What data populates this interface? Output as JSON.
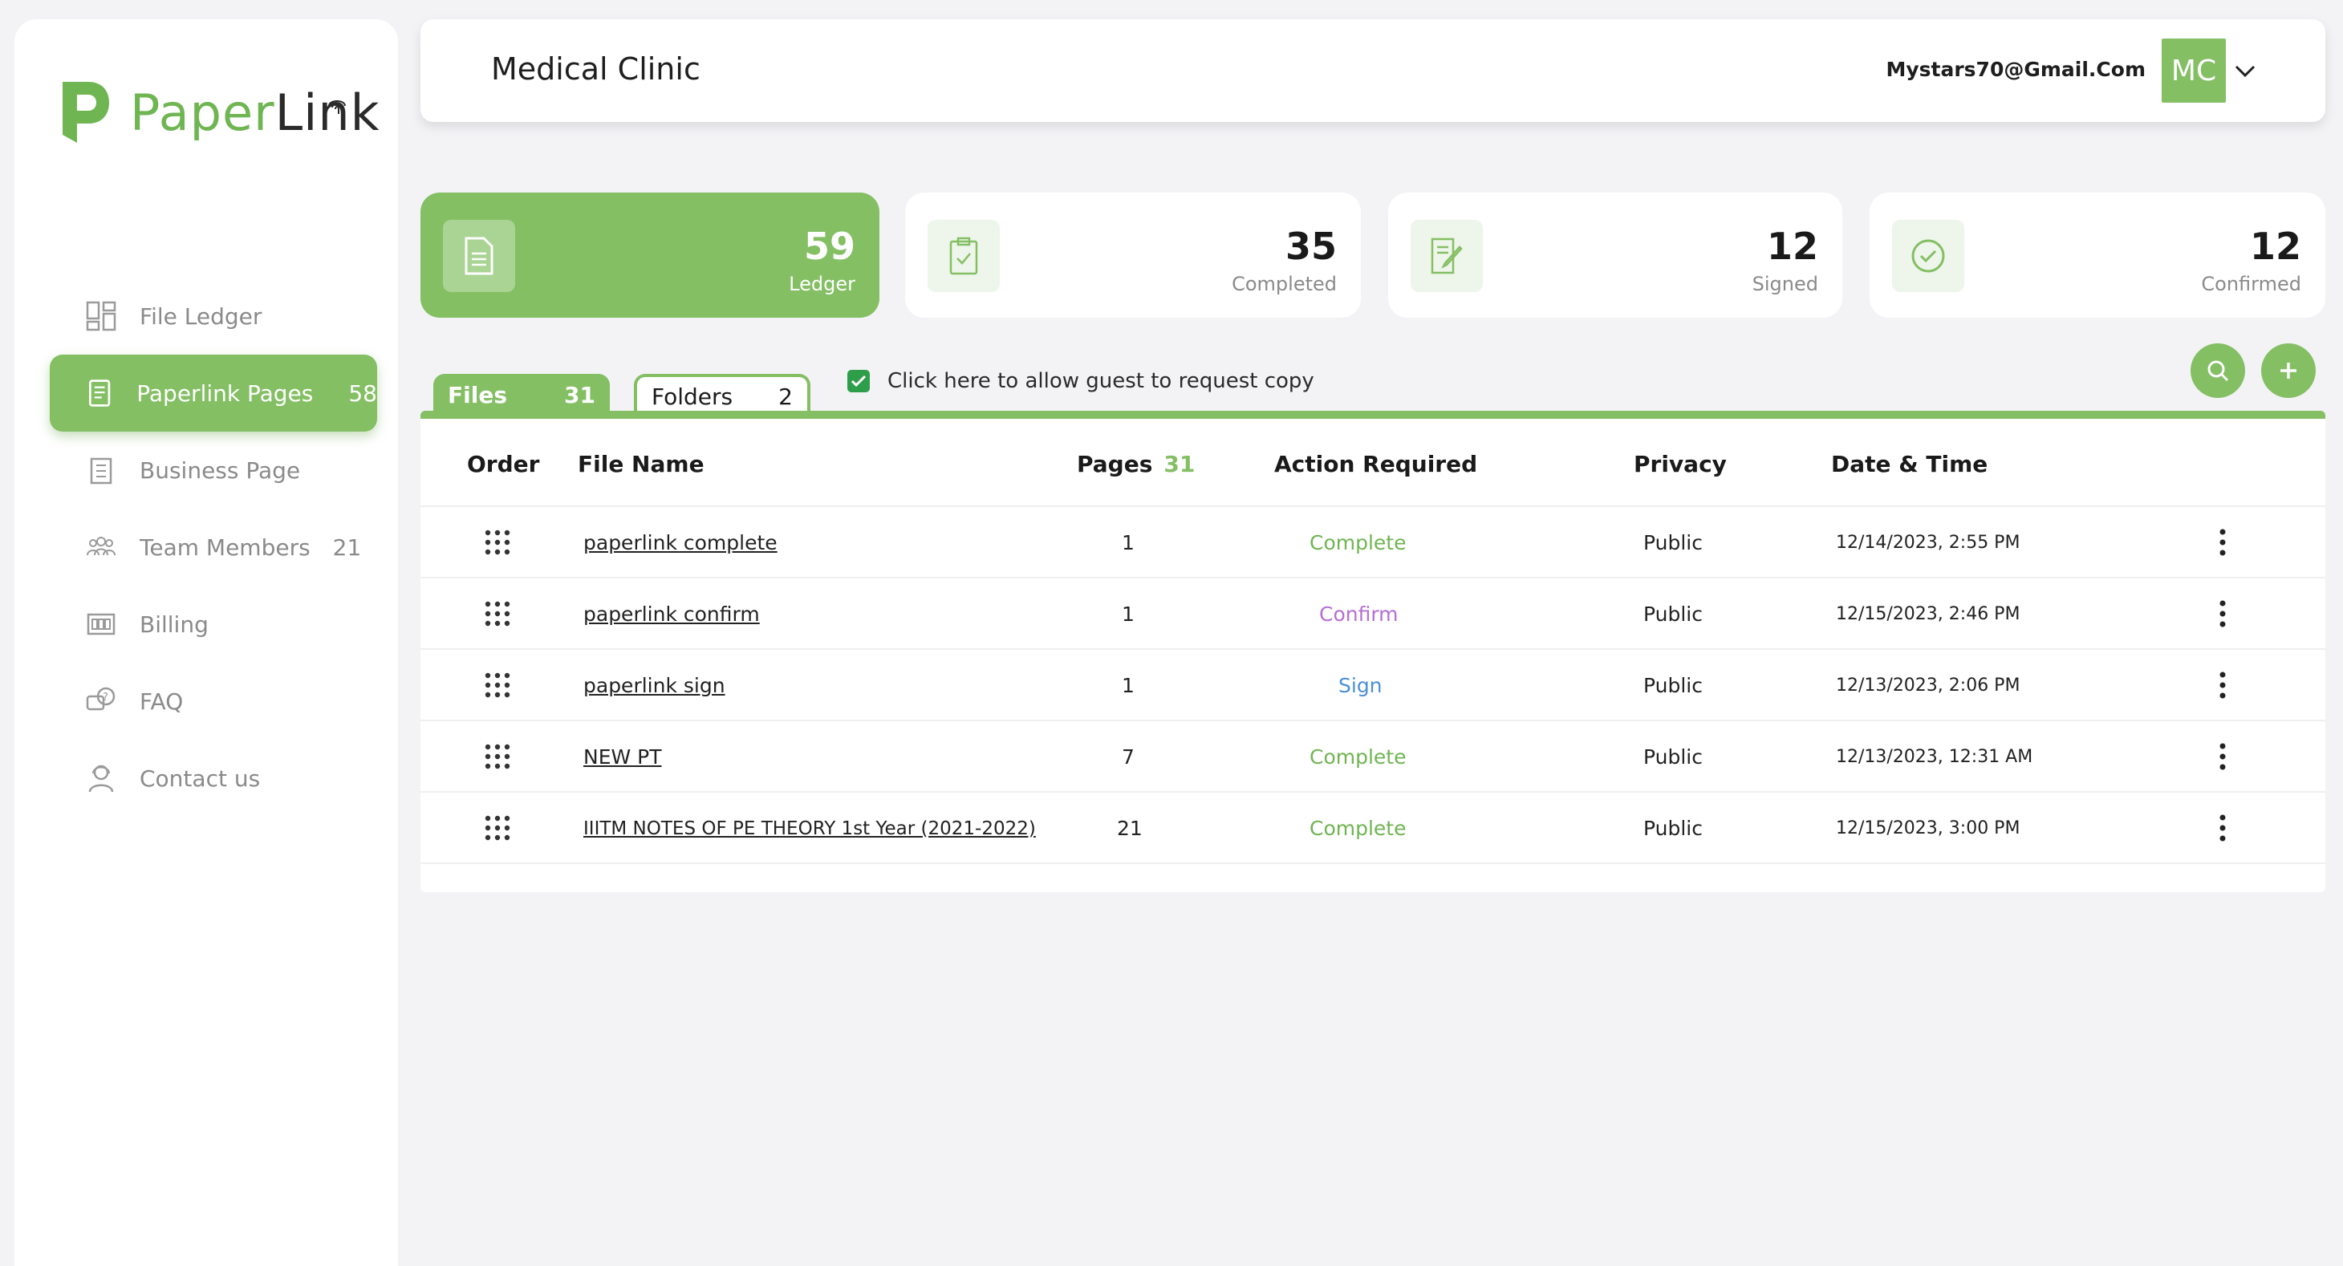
{
  "brand": {
    "name_part1": "Paper",
    "name_part2": "Link",
    "color": "#84bf64"
  },
  "sidebar": {
    "items": [
      {
        "label": "File Ledger",
        "icon": "grid-icon",
        "count": ""
      },
      {
        "label": "Paperlink Pages",
        "icon": "document-icon",
        "count": "58",
        "active": true
      },
      {
        "label": "Business Page",
        "icon": "building-icon",
        "count": ""
      },
      {
        "label": "Team Members",
        "icon": "team-icon",
        "count": "21"
      },
      {
        "label": "Billing",
        "icon": "billing-icon",
        "count": ""
      },
      {
        "label": "FAQ",
        "icon": "faq-icon",
        "count": ""
      },
      {
        "label": "Contact us",
        "icon": "contact-icon",
        "count": ""
      }
    ]
  },
  "header": {
    "title": "Medical Clinic",
    "email": "Mystars70@Gmail.Com",
    "avatar_initials": "MC"
  },
  "stats": [
    {
      "value": "59",
      "label": "Ledger",
      "icon": "document-icon"
    },
    {
      "value": "35",
      "label": "Completed",
      "icon": "clipboard-check-icon"
    },
    {
      "value": "12",
      "label": "Signed",
      "icon": "signature-icon"
    },
    {
      "value": "12",
      "label": "Confirmed",
      "icon": "check-circle-icon"
    }
  ],
  "tabs": {
    "files": {
      "label": "Files",
      "count": "31"
    },
    "folders": {
      "label": "Folders",
      "count": "2"
    }
  },
  "guest_copy": {
    "label": "Click here to allow guest to request copy",
    "checked": true
  },
  "table": {
    "headers": {
      "order": "Order",
      "file_name": "File Name",
      "pages": "Pages",
      "pages_total": "31",
      "action": "Action Required",
      "privacy": "Privacy",
      "datetime": "Date & Time"
    },
    "rows": [
      {
        "file": "paperlink complete",
        "pages": "1",
        "action": "Complete",
        "privacy": "Public",
        "datetime": "12/14/2023, 2:55 PM"
      },
      {
        "file": "paperlink confirm",
        "pages": "1",
        "action": "Confirm",
        "privacy": "Public",
        "datetime": "12/15/2023, 2:46 PM"
      },
      {
        "file": "paperlink sign",
        "pages": "1",
        "action": "Sign",
        "privacy": "Public",
        "datetime": "12/13/2023, 2:06 PM"
      },
      {
        "file": "NEW PT",
        "pages": "7",
        "action": "Complete",
        "privacy": "Public",
        "datetime": "12/13/2023, 12:31 AM"
      },
      {
        "file": "IIITM NOTES OF PE THEORY 1st Year (2021-2022)",
        "pages": "21",
        "action": "Complete",
        "privacy": "Public",
        "datetime": "12/15/2023, 3:00 PM"
      }
    ]
  }
}
